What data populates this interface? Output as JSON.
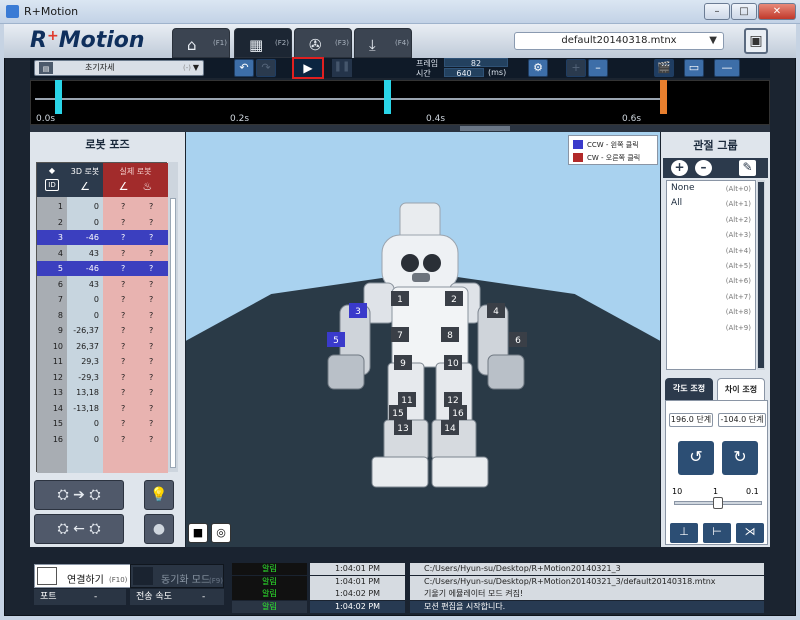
{
  "window": {
    "title": "R+Motion",
    "min": "–",
    "max": "□",
    "close": "✕"
  },
  "logo": {
    "text": "R",
    "plus": "+",
    "rest": "Motion"
  },
  "tabs": [
    {
      "icon": "⌂",
      "key": "(F1)"
    },
    {
      "icon": "▦",
      "key": "(F2)"
    },
    {
      "icon": "✇",
      "key": "(F3)"
    },
    {
      "icon": "⤓",
      "key": "(F4)"
    }
  ],
  "file": {
    "name": "default20140318.mtnx",
    "arrow": "▼"
  },
  "toolbar": {
    "pose_name": "초기자세",
    "pose_mark": "(-)",
    "pose_arrow": "▼",
    "undo": "↶",
    "redo": "↷",
    "play": "▶",
    "pause": "❚❚",
    "frame_label": "프레임",
    "frame_value": "82",
    "time_label": "시간",
    "time_value": "640",
    "time_unit": "(ms)",
    "settings": "⚙",
    "zoom_in": "+",
    "zoom_out": "–",
    "save": "▬",
    "minus": "—"
  },
  "timeline": {
    "ticks": [
      "0.0s",
      "0.2s",
      "0.4s",
      "0.6s"
    ]
  },
  "left": {
    "title": "로봇 포즈",
    "header": {
      "id_top": "◆",
      "id": "ID",
      "d3": "3D 로봇",
      "real": "실제 로봇",
      "angle": "∠",
      "torque": "♨"
    },
    "rows": [
      {
        "id": "1",
        "v3d": "0",
        "r1": "?",
        "r2": "?",
        "sel": false
      },
      {
        "id": "2",
        "v3d": "0",
        "r1": "?",
        "r2": "?",
        "sel": false
      },
      {
        "id": "3",
        "v3d": "-46",
        "r1": "?",
        "r2": "?",
        "sel": true
      },
      {
        "id": "4",
        "v3d": "43",
        "r1": "?",
        "r2": "?",
        "sel": false
      },
      {
        "id": "5",
        "v3d": "-46",
        "r1": "?",
        "r2": "?",
        "sel": true
      },
      {
        "id": "6",
        "v3d": "43",
        "r1": "?",
        "r2": "?",
        "sel": false
      },
      {
        "id": "7",
        "v3d": "0",
        "r1": "?",
        "r2": "?",
        "sel": false
      },
      {
        "id": "8",
        "v3d": "0",
        "r1": "?",
        "r2": "?",
        "sel": false
      },
      {
        "id": "9",
        "v3d": "-26,37",
        "r1": "?",
        "r2": "?",
        "sel": false
      },
      {
        "id": "10",
        "v3d": "26,37",
        "r1": "?",
        "r2": "?",
        "sel": false
      },
      {
        "id": "11",
        "v3d": "29,3",
        "r1": "?",
        "r2": "?",
        "sel": false
      },
      {
        "id": "12",
        "v3d": "-29,3",
        "r1": "?",
        "r2": "?",
        "sel": false
      },
      {
        "id": "13",
        "v3d": "13,18",
        "r1": "?",
        "r2": "?",
        "sel": false
      },
      {
        "id": "14",
        "v3d": "-13,18",
        "r1": "?",
        "r2": "?",
        "sel": false
      },
      {
        "id": "15",
        "v3d": "0",
        "r1": "?",
        "r2": "?",
        "sel": false
      },
      {
        "id": "16",
        "v3d": "0",
        "r1": "?",
        "r2": "?",
        "sel": false
      }
    ],
    "to_real": "➔",
    "to_3d": "←",
    "bulb_on": "💡",
    "bulb_off": "●"
  },
  "legend": {
    "ccw": "CCW - 왼쪽 클릭",
    "cw": "CW - 오른쪽 클릭",
    "ccw_color": "#3a3acb",
    "cw_color": "#b22a2a"
  },
  "robot_labels": [
    "1",
    "2",
    "3",
    "4",
    "5",
    "6",
    "7",
    "8",
    "9",
    "10",
    "11",
    "12",
    "13",
    "14",
    "15",
    "16"
  ],
  "camera": {
    "cam": "■",
    "target": "◎"
  },
  "right": {
    "title": "관절 그룹",
    "add": "+",
    "remove": "–",
    "edit": "✎",
    "groups": [
      {
        "name": "None",
        "key": "(Alt+0)"
      },
      {
        "name": "All",
        "key": "(Alt+1)"
      },
      {
        "name": "",
        "key": "(Alt+2)"
      },
      {
        "name": "",
        "key": "(Alt+3)"
      },
      {
        "name": "",
        "key": "(Alt+4)"
      },
      {
        "name": "",
        "key": "(Alt+5)"
      },
      {
        "name": "",
        "key": "(Alt+6)"
      },
      {
        "name": "",
        "key": "(Alt+7)"
      },
      {
        "name": "",
        "key": "(Alt+8)"
      },
      {
        "name": "",
        "key": "(Alt+9)"
      }
    ],
    "tab_angle": "각도 조정",
    "tab_diff": "차이 조정",
    "step_left": "196.0 단계",
    "step_right": "-104.0 단계",
    "rot_ccw": "↺",
    "rot_cw": "↻",
    "scale": {
      "left": "10",
      "mid": "1",
      "right": "0.1",
      "value": 1
    }
  },
  "bottom": {
    "connect": "연결하기",
    "connect_key": "(F10)",
    "sync": "동기화 모드",
    "sync_key": "(F9)",
    "port_label": "포트",
    "port_value": "-",
    "speed_label": "전송 속도",
    "speed_value": "-",
    "logs": [
      {
        "level": "알림",
        "time": "1:04:01 PM",
        "msg": "C:/Users/Hyun-su/Desktop/R+Motion20140321_3"
      },
      {
        "level": "알림",
        "time": "1:04:01 PM",
        "msg": "C:/Users/Hyun-su/Desktop/R+Motion20140321_3/default20140318.mtnx"
      },
      {
        "level": "알림",
        "time": "1:04:02 PM",
        "msg": "기울기 에뮬레이터 모드 켜짐!"
      },
      {
        "level": "알림",
        "time": "1:04:02 PM",
        "msg": "모션 편집을 시작합니다."
      }
    ]
  }
}
